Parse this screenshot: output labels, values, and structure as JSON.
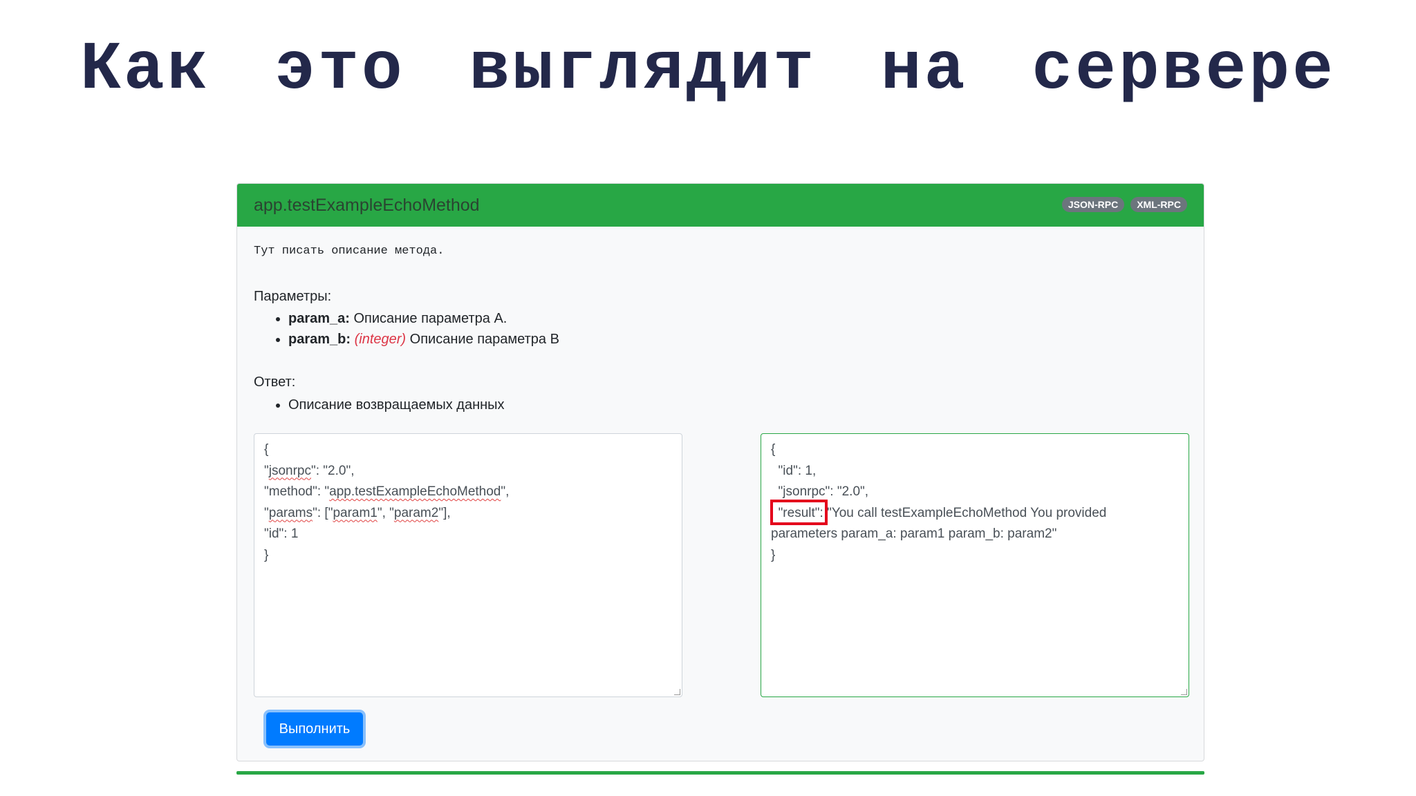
{
  "slide": {
    "title": "Как это выглядит на сервере"
  },
  "card": {
    "method_name": "app.testExampleEchoMethod",
    "badges": [
      "JSON-RPC",
      "XML-RPC"
    ],
    "description": "Тут писать описание метода.",
    "params_label": "Параметры:",
    "params": [
      {
        "name": "param_a:",
        "type": "",
        "text": " Описание параметра А."
      },
      {
        "name": "param_b:",
        "type": "(integer)",
        "text": " Описание параметра В"
      }
    ],
    "response_label": "Ответ:",
    "response_items": [
      "Описание возвращаемых данных"
    ],
    "request_lines": [
      "{",
      "\"jsonrpc\": \"2.0\",",
      "\"method\": \"app.testExampleEchoMethod\",",
      "\"params\": [\"param1\", \"param2\"],",
      "\"id\": 1",
      "}"
    ],
    "response_lines": [
      "{",
      "  \"id\": 1,",
      "  \"jsonrpc\": \"2.0\",",
      "  \"result\": \"You call testExampleEchoMethod You provided parameters param_a: param1 param_b: param2\"",
      "}"
    ],
    "run_button_label": "Выполнить"
  },
  "colors": {
    "header": "#28a745",
    "button": "#007bff",
    "highlight": "#e4001b",
    "title": "#23284a"
  }
}
